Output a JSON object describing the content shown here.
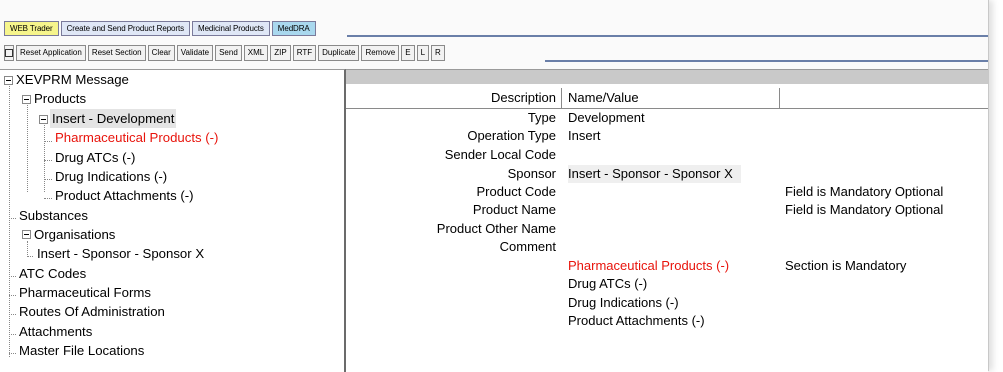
{
  "tabs": [
    "WEB Trader",
    "Create and Send Product Reports",
    "Medicinal Products",
    "MedDRA"
  ],
  "toolbar": {
    "square_icon": "square-icon",
    "buttons": [
      "Reset Application",
      "Reset Section",
      "Clear",
      "Validate",
      "Send",
      "XML",
      "ZIP",
      "RTF",
      "Duplicate",
      "Remove",
      "E",
      "L",
      "R"
    ]
  },
  "tree": {
    "root": "XEVPRM Message",
    "products": "Products",
    "insert_development": "Insert - Development",
    "pharmaceutical_products": "Pharmaceutical Products (-)",
    "drug_atcs": "Drug ATCs (-)",
    "drug_indications": "Drug Indications (-)",
    "product_attachments": "Product Attachments (-)",
    "substances": "Substances",
    "organisations": "Organisations",
    "insert_sponsor": "Insert - Sponsor - Sponsor X",
    "atc_codes": "ATC Codes",
    "pharmaceutical_forms": "Pharmaceutical Forms",
    "routes_of_administration": "Routes Of Administration",
    "attachments": "Attachments",
    "master_file_locations": "Master File Locations"
  },
  "details": {
    "header": {
      "description": "Description",
      "name_value": "Name/Value"
    },
    "rows": [
      {
        "description": "Type",
        "value": "Development",
        "note": ""
      },
      {
        "description": "Operation Type",
        "value": "Insert",
        "note": ""
      },
      {
        "description": "Sender Local Code",
        "value": "",
        "note": ""
      },
      {
        "description": "Sponsor",
        "value": "Insert - Sponsor - Sponsor X",
        "note": ""
      },
      {
        "description": "Product Code",
        "value": "",
        "note": "Field is Mandatory Optional"
      },
      {
        "description": "Product Name",
        "value": "",
        "note": "Field is Mandatory Optional"
      },
      {
        "description": "Product Other Name",
        "value": "",
        "note": ""
      },
      {
        "description": "Comment",
        "value": "",
        "note": ""
      },
      {
        "description": "",
        "value": "Pharmaceutical Products (-)",
        "note": "Section is Mandatory"
      },
      {
        "description": "",
        "value": "Drug ATCs (-)",
        "note": ""
      },
      {
        "description": "",
        "value": "Drug Indications (-)",
        "note": ""
      },
      {
        "description": "",
        "value": "Product Attachments (-)",
        "note": ""
      }
    ]
  },
  "colors": {
    "required": "#e8140c",
    "tab_yellow": "#f6f58c",
    "tab_blue": "#a9d8ee",
    "strip": "#6a7fa8"
  }
}
